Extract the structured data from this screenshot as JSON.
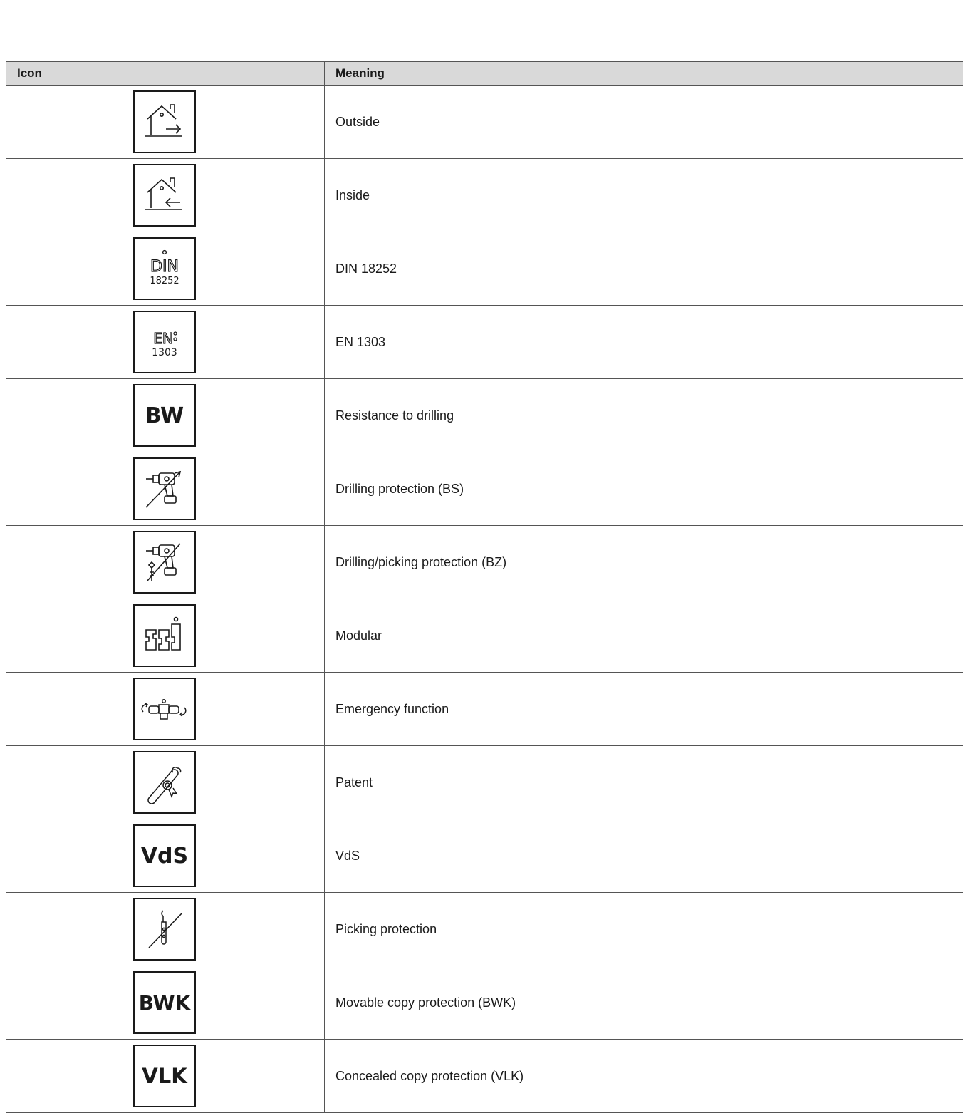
{
  "table": {
    "headers": {
      "icon": "Icon",
      "meaning": "Meaning"
    },
    "rows": [
      {
        "icon": "house-outside-icon",
        "meaning": "Outside"
      },
      {
        "icon": "house-inside-icon",
        "meaning": "Inside"
      },
      {
        "icon": "din-18252-icon",
        "icon_text": "DIN",
        "icon_subtext": "18252",
        "meaning": "DIN 18252"
      },
      {
        "icon": "en-1303-icon",
        "icon_text": "EN",
        "icon_subtext": "1303",
        "meaning": "EN 1303"
      },
      {
        "icon": "bw-icon",
        "icon_text": "BW",
        "meaning": "Resistance to drilling"
      },
      {
        "icon": "drill-protection-icon",
        "meaning": "Drilling protection (BS)"
      },
      {
        "icon": "drill-pick-protection-icon",
        "meaning": "Drilling/picking protection (BZ)"
      },
      {
        "icon": "modular-icon",
        "meaning": "Modular"
      },
      {
        "icon": "emergency-function-icon",
        "meaning": "Emergency function"
      },
      {
        "icon": "patent-icon",
        "meaning": "Patent"
      },
      {
        "icon": "vds-icon",
        "icon_text": "VdS",
        "meaning": "VdS"
      },
      {
        "icon": "picking-protection-icon",
        "meaning": "Picking protection"
      },
      {
        "icon": "bwk-icon",
        "icon_text": "BWK",
        "meaning": "Movable copy protection (BWK)"
      },
      {
        "icon": "vlk-icon",
        "icon_text": "VLK",
        "meaning": "Concealed copy protection (VLK)"
      }
    ]
  },
  "colors": {
    "header_bg": "#d9d9d9",
    "border": "#555555",
    "icon_stroke": "#1a1a1a"
  }
}
